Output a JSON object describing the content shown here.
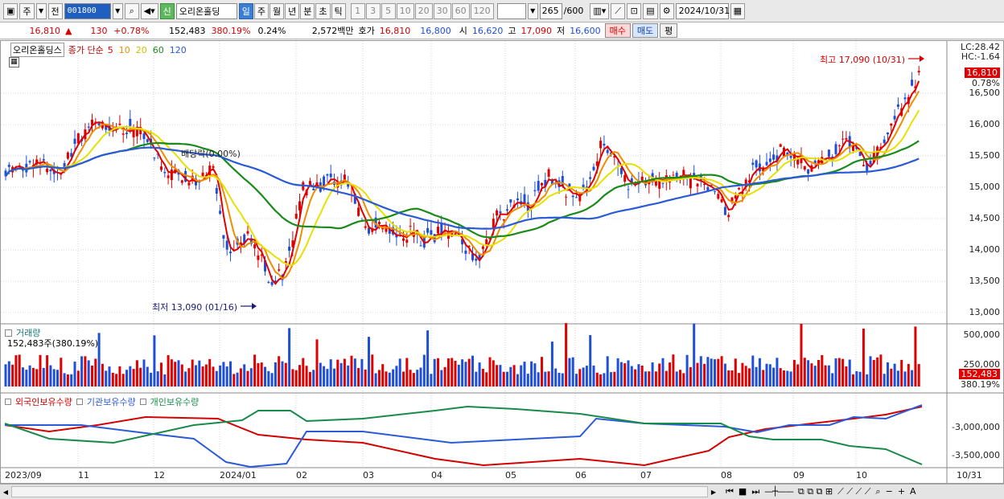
{
  "toolbar": {
    "type_label": "주",
    "jeon_label": "전",
    "code_value": "001800",
    "sin_label": "신",
    "stock_name": "오리온홀딩",
    "periods": [
      "일",
      "주",
      "월",
      "년",
      "분",
      "초",
      "틱"
    ],
    "selected_period": "일",
    "intervals": [
      "1",
      "3",
      "5",
      "10",
      "20",
      "30",
      "60",
      "120"
    ],
    "count_value": "265",
    "count_max": "/600",
    "date_value": "2024/10/31"
  },
  "quote": {
    "price": "16,810",
    "change_icon": "up-triangle-icon",
    "change": "130",
    "change_pct": "+0.78%",
    "volume": "152,483",
    "volume_ratio": "380.19%",
    "turnover": "0.24%",
    "amount": "2,572백만",
    "hoga_label": "호가",
    "ask": "16,810",
    "bid": "16,800",
    "open_label": "시",
    "open": "16,620",
    "high_label": "고",
    "high": "17,090",
    "low_label": "저",
    "low": "16,600",
    "buy_label": "매수",
    "sell_label": "매도",
    "pyeong_label": "평"
  },
  "main_legend": {
    "name": "오리온홀딩스",
    "indicator": "종가 단순",
    "ma": [
      {
        "label": "5",
        "color": "#e00000"
      },
      {
        "label": "10",
        "color": "#f08c00"
      },
      {
        "label": "20",
        "color": "#e8e000"
      },
      {
        "label": "60",
        "color": "#1a8a1a"
      },
      {
        "label": "120",
        "color": "#2a5ad8"
      }
    ]
  },
  "price_axis": [
    "16,500",
    "16,000",
    "15,500",
    "15,000",
    "14,500",
    "14,000",
    "13,500",
    "13,000"
  ],
  "lc_label": "LC:28.42",
  "hc_label": "HC:-1.64",
  "last_price_tag": "16,810",
  "last_pct_tag": "0.78%",
  "annotations": {
    "high": "최고 17,090 (10/31)",
    "low": "최저 13,090 (01/16)",
    "dividend": "배당락(0.00%)"
  },
  "volume_panel": {
    "title": "거래량",
    "value": "152,483주(380.19%)",
    "axis": [
      "500,000",
      "250,000"
    ],
    "tag_value": "152,483",
    "tag_pct": "380.19%"
  },
  "holding_panel": {
    "series": [
      {
        "name": "외국인보유수량",
        "color": "#d40000"
      },
      {
        "name": "기관보유수량",
        "color": "#2a5ad8"
      },
      {
        "name": "개인보유수량",
        "color": "#1a8a4a"
      }
    ],
    "axis": [
      "-3,000,000",
      "-3,500,000"
    ]
  },
  "x_axis": [
    {
      "label": "2023/09"
    },
    {
      "label": "11"
    },
    {
      "label": "12"
    },
    {
      "label": "2024/01"
    },
    {
      "label": "02"
    },
    {
      "label": "03"
    },
    {
      "label": "04"
    },
    {
      "label": "05"
    },
    {
      "label": "06"
    },
    {
      "label": "07"
    },
    {
      "label": "08"
    },
    {
      "label": "09"
    },
    {
      "label": "10"
    },
    {
      "label": "10/31"
    }
  ],
  "colors": {
    "up": "#e00000",
    "down": "#1f4fd8",
    "ma60": "#1a8a1a",
    "ma120": "#2a5ad8"
  }
}
